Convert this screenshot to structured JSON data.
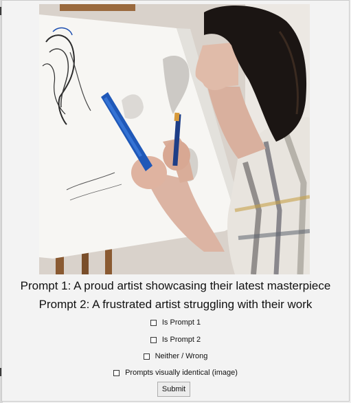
{
  "prompts": {
    "prompt1": "Prompt 1: A proud artist showcasing their latest masterpiece",
    "prompt2": "Prompt 2: A frustrated artist struggling with their work"
  },
  "options": [
    {
      "label": "Is Prompt 1",
      "checked": false
    },
    {
      "label": "Is Prompt 2",
      "checked": false
    },
    {
      "label": "Neither / Wrong",
      "checked": false
    },
    {
      "label": "Prompts visually identical (image)",
      "checked": false
    }
  ],
  "submit_label": "Submit",
  "colors": {
    "background": "#f0f0f0",
    "canvas": "#f7f6f3",
    "marker_blue": "#1f58b8",
    "hair": "#1b1513"
  }
}
